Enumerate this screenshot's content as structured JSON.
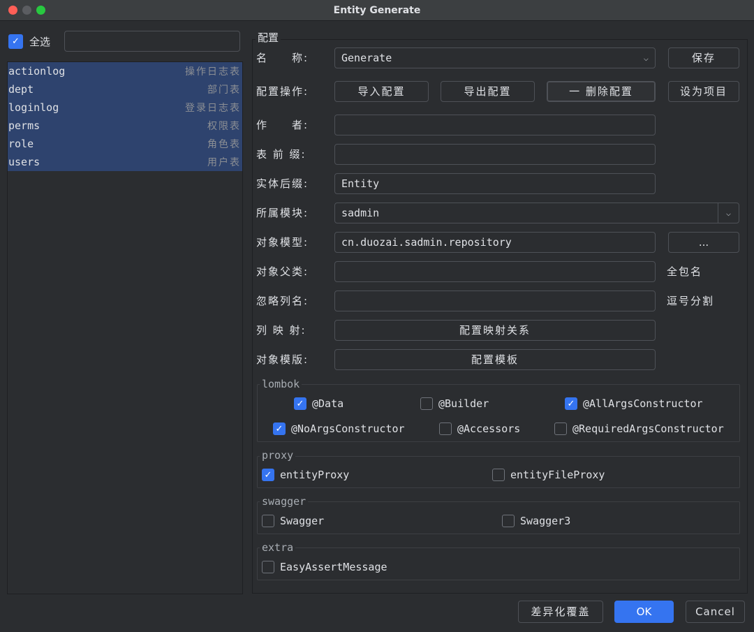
{
  "window": {
    "title": "Entity Generate"
  },
  "left": {
    "select_all_label": "全选",
    "select_all_checked": true,
    "filter_value": "",
    "tables": [
      {
        "name": "actionlog",
        "comment": "操作日志表"
      },
      {
        "name": "dept",
        "comment": "部门表"
      },
      {
        "name": "loginlog",
        "comment": "登录日志表"
      },
      {
        "name": "perms",
        "comment": "权限表"
      },
      {
        "name": "role",
        "comment": "角色表"
      },
      {
        "name": "users",
        "comment": "用户表"
      }
    ]
  },
  "config": {
    "group_title": "配置",
    "name_label": "名　　称:",
    "name_value": "Generate",
    "save_button": "保存",
    "ops_label": "配置操作:",
    "import_button": "导入配置",
    "export_button": "导出配置",
    "delete_button": "一 删除配置",
    "set_project_button": "设为项目",
    "author_label": "作　　者:",
    "author_value": "",
    "prefix_label": "表 前 缀:",
    "prefix_value": "",
    "suffix_label": "实体后缀:",
    "suffix_value": "Entity",
    "module_label": "所属模块:",
    "module_value": "sadmin",
    "package_label": "对象模型:",
    "package_value": "cn.duozai.sadmin.repository",
    "browse_button": "...",
    "parent_label": "对象父类:",
    "parent_value": "",
    "parent_hint": "全包名",
    "ignore_label": "忽略列名:",
    "ignore_value": "",
    "ignore_hint": "逗号分割",
    "mapping_label": "列 映 射:",
    "mapping_button": "配置映射关系",
    "template_label": "对象模版:",
    "template_button": "配置模板"
  },
  "lombok": {
    "title": "lombok",
    "options": [
      {
        "label": "@Data",
        "checked": true
      },
      {
        "label": "@Builder",
        "checked": false
      },
      {
        "label": "@AllArgsConstructor",
        "checked": true
      },
      {
        "label": "@NoArgsConstructor",
        "checked": true
      },
      {
        "label": "@Accessors",
        "checked": false
      },
      {
        "label": "@RequiredArgsConstructor",
        "checked": false
      }
    ]
  },
  "proxy": {
    "title": "proxy",
    "options": [
      {
        "label": "entityProxy",
        "checked": true
      },
      {
        "label": "entityFileProxy",
        "checked": false
      }
    ]
  },
  "swagger": {
    "title": "swagger",
    "options": [
      {
        "label": "Swagger",
        "checked": false
      },
      {
        "label": "Swagger3",
        "checked": false
      }
    ]
  },
  "extra": {
    "title": "extra",
    "options": [
      {
        "label": "EasyAssertMessage",
        "checked": false
      }
    ]
  },
  "footer": {
    "diff_button": "差异化覆盖",
    "ok_button": "OK",
    "cancel_button": "Cancel"
  },
  "colors": {
    "close": "#ff5f57",
    "minimize": "#febc2e",
    "maximize": "#28c840",
    "accent": "#3574f0",
    "selection": "#2e436e"
  },
  "icons": {
    "checkbox_tick": "✓",
    "dropdown": "chevron-down-icon"
  }
}
